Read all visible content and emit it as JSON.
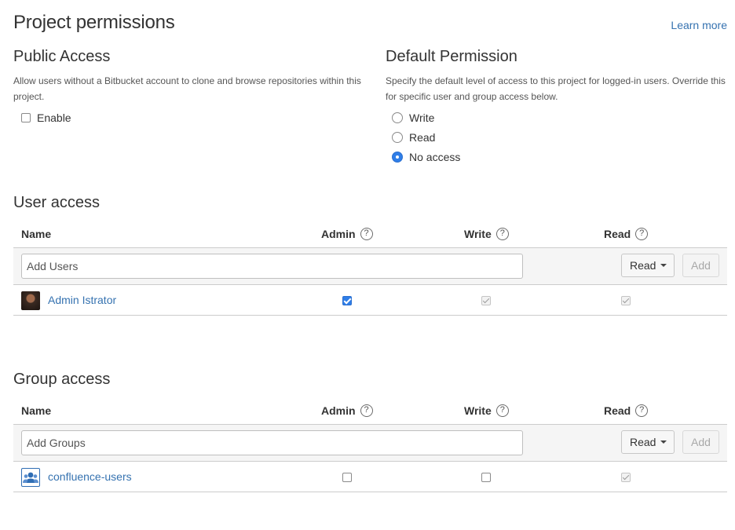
{
  "page": {
    "title": "Project permissions",
    "learn_more": "Learn more"
  },
  "public_access": {
    "title": "Public Access",
    "description": "Allow users without a Bitbucket account to clone and browse repositories within this project.",
    "enable_label": "Enable",
    "enabled": false
  },
  "default_permission": {
    "title": "Default Permission",
    "description": "Specify the default level of access to this project for logged-in users. Override this for specific user and group access below.",
    "options": [
      {
        "label": "Write",
        "selected": false
      },
      {
        "label": "Read",
        "selected": false
      },
      {
        "label": "No access",
        "selected": true
      }
    ]
  },
  "user_access": {
    "title": "User access",
    "columns": {
      "name": "Name",
      "admin": "Admin",
      "write": "Write",
      "read": "Read"
    },
    "add_placeholder": "Add Users",
    "permission_select": "Read",
    "add_button": "Add",
    "rows": [
      {
        "name": "Admin Istrator",
        "admin": "checked",
        "write": "implied",
        "read": "implied"
      }
    ]
  },
  "group_access": {
    "title": "Group access",
    "columns": {
      "name": "Name",
      "admin": "Admin",
      "write": "Write",
      "read": "Read"
    },
    "add_placeholder": "Add Groups",
    "permission_select": "Read",
    "add_button": "Add",
    "rows": [
      {
        "name": "confluence-users",
        "admin": "unchecked",
        "write": "unchecked",
        "read": "implied"
      }
    ]
  },
  "icons": {
    "help": "?",
    "help_icon": "question-circle-icon",
    "user_avatar": "user-avatar",
    "group_avatar": "group-icon"
  },
  "colors": {
    "link": "#3572b0",
    "checkbox_checked": "#2f7ee8",
    "border": "#cccccc",
    "add_row_bg": "#f5f5f5"
  }
}
